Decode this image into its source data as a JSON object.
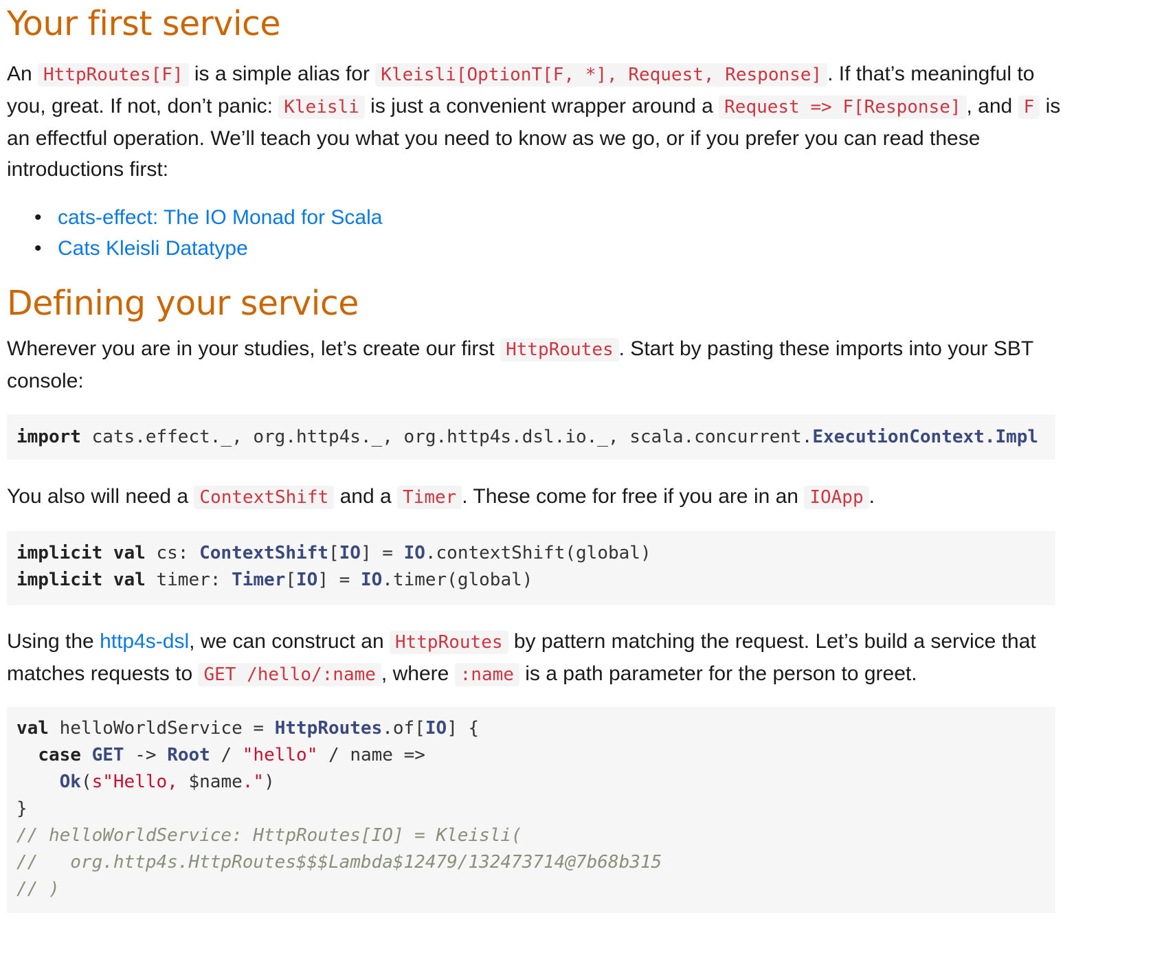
{
  "section1": {
    "title": "Your first service",
    "para": {
      "t1": "An ",
      "c1": "HttpRoutes[F]",
      "t2": " is a simple alias for ",
      "c2": "Kleisli[OptionT[F, *], Request, Response]",
      "t3": ". If that’s meaningful to you, great. If not, don’t panic: ",
      "c3": "Kleisli",
      "t4": " is just a convenient wrapper around a ",
      "c4": "Request => F[Response]",
      "t5": ", and ",
      "c5": "F",
      "t6": " is an effectful operation. We’ll teach you what you need to know as we go, or if you prefer you can read these introductions first:"
    },
    "links": [
      "cats-effect: The IO Monad for Scala",
      "Cats Kleisli Datatype"
    ]
  },
  "section2": {
    "title": "Defining your service",
    "para1": {
      "t1": "Wherever you are in your studies, let’s create our first ",
      "c1": "HttpRoutes",
      "t2": ". Start by pasting these imports into your SBT console:"
    },
    "code1": {
      "kw": "import",
      "rest": " cats.effect._, org.http4s._, org.http4s.dsl.io._, scala.concurrent.",
      "ty": "ExecutionContext.Impl"
    },
    "para2": {
      "t1": "You also will need a ",
      "c1": "ContextShift",
      "t2": " and a ",
      "c2": "Timer",
      "t3": ". These come for free if you are in an ",
      "c3": "IOApp",
      "t4": "."
    },
    "code2": {
      "l1_kw": "implicit val",
      "l1_a": " cs: ",
      "l1_ty": "ContextShift",
      "l1_b": "[",
      "l1_io": "IO",
      "l1_c": "] = ",
      "l1_io2": "IO",
      "l1_d": ".contextShift(global)",
      "l2_kw": "implicit val",
      "l2_a": " timer: ",
      "l2_ty": "Timer",
      "l2_b": "[",
      "l2_io": "IO",
      "l2_c": "] = ",
      "l2_io2": "IO",
      "l2_d": ".timer(global)"
    },
    "para3": {
      "t1": "Using the ",
      "link": "http4s-dsl",
      "t2": ", we can construct an ",
      "c1": "HttpRoutes",
      "t3": " by pattern matching the request. Let’s build a service that matches requests to ",
      "c2": "GET /hello/:name",
      "t4": ", where ",
      "c3": ":name",
      "t5": " is a path parameter for the person to greet."
    },
    "code3": {
      "l1_kw": "val",
      "l1_a": " helloWorldService = ",
      "l1_ty": "HttpRoutes",
      "l1_b": ".of[",
      "l1_io": "IO",
      "l1_c": "] {",
      "l2_indent": "  ",
      "l2_kw": "case",
      "l2_sp": " ",
      "l2_get": "GET",
      "l2_a": " -> ",
      "l2_root": "Root",
      "l2_b": " / ",
      "l2_str": "\"hello\"",
      "l2_c": " / name =>",
      "l3_indent": "    ",
      "l3_ok": "Ok",
      "l3_a": "(",
      "l3_s1": "s\"Hello, ",
      "l3_var": "$name",
      "l3_s2": ".\"",
      "l3_b": ")",
      "l4": "}",
      "c1": "// helloWorldService: HttpRoutes[IO] = Kleisli(",
      "c2": "//   org.http4s.HttpRoutes$$$Lambda$12479/132473714@7b68b315",
      "c3": "// )"
    }
  }
}
